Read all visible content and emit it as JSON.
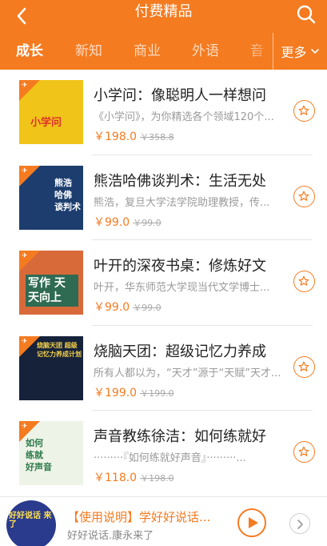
{
  "header": {
    "title": "付费精品"
  },
  "tabs": [
    {
      "label": "成长",
      "active": true
    },
    {
      "label": "新知",
      "active": false
    },
    {
      "label": "商业",
      "active": false
    },
    {
      "label": "外语",
      "active": false
    },
    {
      "label": "音",
      "active": false
    }
  ],
  "more_label": "更多",
  "items": [
    {
      "title": "小学问：像聪明人一样想问",
      "desc": "《小学问》，为你精选各个领域120个...",
      "price": "￥198.0",
      "old_price": "￥358.8",
      "cover_text": "小学问",
      "cover_bg": "#f0c419"
    },
    {
      "title": "熊浩哈佛谈判术：生活无处",
      "desc": "熊浩，复旦大学法学院助理教授，传...",
      "price": "￥99.0",
      "old_price": "￥99.0",
      "cover_text": "熊浩 哈佛 谈判术",
      "cover_bg": "#1c3d6e"
    },
    {
      "title": "叶开的深夜书桌：修炼好文",
      "desc": "叶开，华东师范大学现当代文学博士...",
      "price": "￥99.0",
      "old_price": "￥99.0",
      "cover_text": "写作 天天向上",
      "cover_bg": "#d86a3a"
    },
    {
      "title": "烧脑天团：超级记忆力养成",
      "desc": "所有人都以为，“天才”源于“天赋”天才...",
      "price": "￥199.0",
      "old_price": "￥199.0",
      "cover_text": "烧脑天团 超级记忆力养成计划",
      "cover_bg": "#16223a"
    },
    {
      "title": "声音教练徐洁：如何练就好",
      "desc": "·········『如何练就好声音』·········...",
      "price": "￥118.0",
      "old_price": "￥198.0",
      "cover_text": "如何 练就 好声音",
      "cover_bg": "#eef3e8"
    }
  ],
  "player": {
    "title": "【使用说明】学好好说话...",
    "subtitle": "好好说话.康永来了",
    "thumb_text": "好好说话 来了"
  },
  "colors": {
    "brand": "#f47b20"
  }
}
